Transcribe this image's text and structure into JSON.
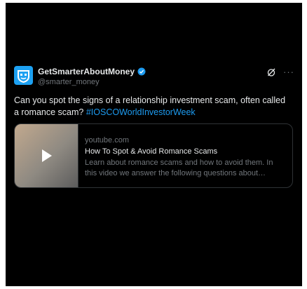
{
  "tweet": {
    "author_name": "GetSmarterAboutMoney",
    "handle": "@smarter_money",
    "text": "Can you spot the signs of a relationship investment scam, often called a romance scam? ",
    "hashtag": "#IOSCOWorldInvestorWeek",
    "more": "···"
  },
  "card": {
    "domain": "youtube.com",
    "title": "How To Spot & Avoid Romance Scams",
    "description": "Learn about romance scams and how to avoid them. In this video we answer the following questions about romance ..."
  },
  "colors": {
    "background": "#000000",
    "text": "#e7e9ea",
    "muted": "#71767b",
    "link": "#1d9bf0",
    "avatar": "#1da1f2"
  },
  "icons": [
    "logo-icon",
    "verified-icon",
    "grok-icon",
    "more-icon",
    "play-icon"
  ]
}
